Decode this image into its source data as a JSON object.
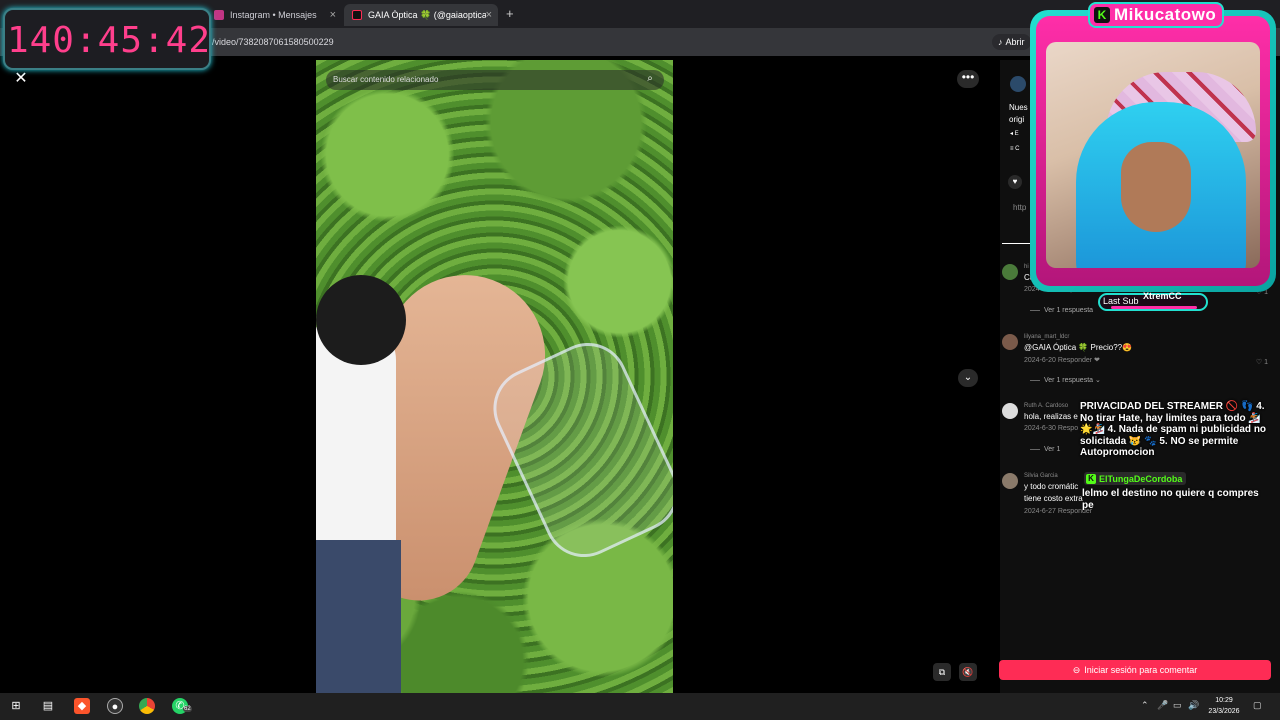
{
  "browser": {
    "tabs": [
      {
        "label": "Instagram • Mensajes",
        "active": false
      },
      {
        "label": "GAIA Óptica 🍀 (@gaiaoptica...",
        "active": true
      }
    ],
    "new_tab": "+",
    "url": "/video/7382087061580500229",
    "open_app": "Abrir"
  },
  "timer": {
    "value": "140:45:42"
  },
  "video": {
    "search_placeholder": "Buscar contenido relacionado",
    "more": "•••",
    "scroll_down": "⌄"
  },
  "sidebar": {
    "desc_line1": "Nues",
    "desc_line2": "origi",
    "link_prefix": "http"
  },
  "comments": [
    {
      "user": "hi",
      "body": "Cu",
      "meta": "2024-6-1?  Responder",
      "likes": "♡ 1",
      "replies": "Ver 1 respuesta"
    },
    {
      "user": "lilyana_mart_ldcr",
      "body": "@GAIA Óptica 🍀  Precio??😍",
      "meta": "2024-6-20   Responder  ❤",
      "likes": "♡ 1",
      "replies": "Ver 1 respuesta ⌄"
    },
    {
      "user": "Ruth A. Cardoso",
      "body": "hola, realizas e",
      "meta": "2024-6-30    Respo",
      "likes": "",
      "replies": "Ver 1"
    },
    {
      "user": "Silvia Garcia",
      "body": "y todo cromátic",
      "body2": "tiene costo extra",
      "meta": "2024-6-27    Responder",
      "likes": "",
      "replies": ""
    }
  ],
  "login_button": "Iniciar sesión para comentar",
  "stream": {
    "title": "Mikucatowo",
    "last_sub_label": "Last Sub",
    "last_sub_name": "XtremCC",
    "rules": "PRIVACIDAD DEL STREAMER 🚫 👣 4. No tirar Hate, hay limites para todo 🏂🌟🏂 4. Nada de spam ni publicidad no solicitada 😿 🐾 5. NO se permite Autopromocion",
    "chat_user": "ElTungaDeCordoba",
    "chat_message": "lelmo el destino no quiere q compres pe"
  },
  "taskbar": {
    "whatsapp_badge": "62",
    "time": "10:29",
    "date": "23/3/2026"
  },
  "colors": {
    "tiktok_red": "#fe2c55",
    "timer_pink": "#ff3f8c",
    "cam_cyan": "#22e0d0",
    "cam_pink": "#ff2ea8",
    "kick_green": "#53fc18"
  }
}
